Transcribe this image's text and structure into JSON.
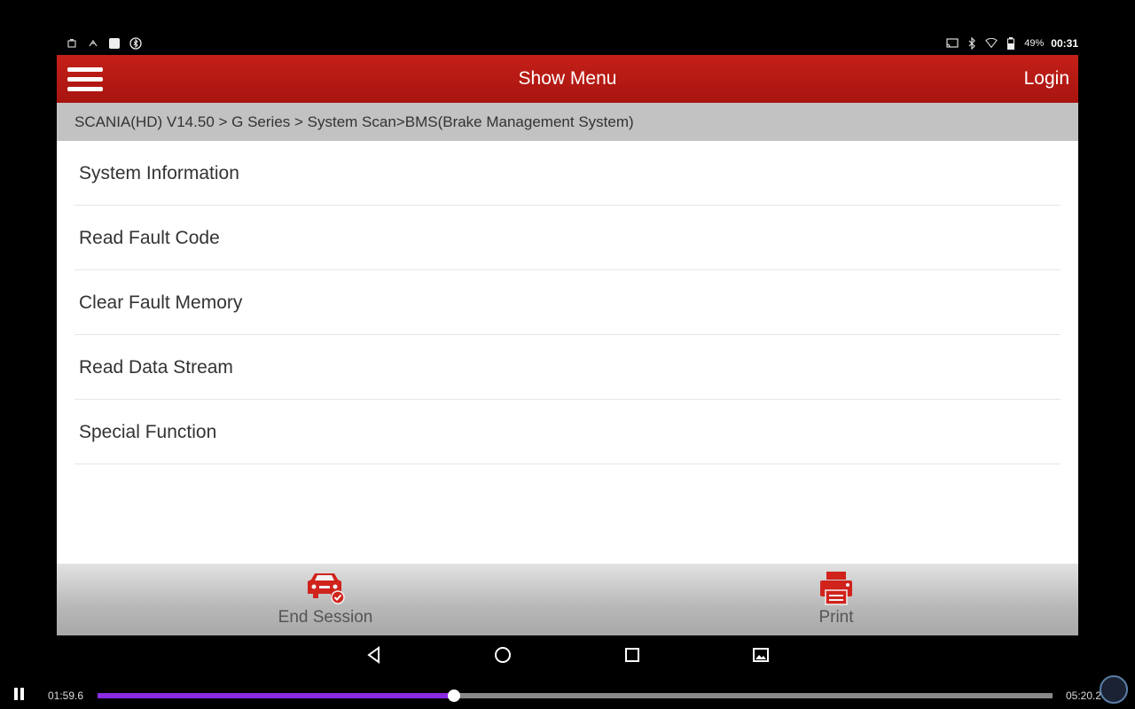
{
  "status_bar": {
    "battery": "49%",
    "time": "00:31",
    "icons_left": [
      "screenshot-icon",
      "usb-debug-icon",
      "notification-icon",
      "bluetooth-settings-icon"
    ],
    "icons_right": [
      "cast-icon",
      "bluetooth-icon",
      "wifi-icon",
      "battery-icon"
    ]
  },
  "header": {
    "title": "Show Menu",
    "login_label": "Login"
  },
  "breadcrumb": "SCANIA(HD) V14.50 > G Series > System Scan>BMS(Brake Management System)",
  "menu": {
    "items": [
      {
        "label": "System Information"
      },
      {
        "label": "Read Fault Code"
      },
      {
        "label": "Clear Fault Memory"
      },
      {
        "label": "Read Data Stream"
      },
      {
        "label": "Special Function"
      }
    ]
  },
  "bottom_bar": {
    "end_session_label": "End Session",
    "print_label": "Print"
  },
  "player": {
    "current_time": "01:59.6",
    "total_time": "05:20.2",
    "progress": 0.373
  },
  "colors": {
    "header": "#b3170f",
    "accent_icon": "#d0231c",
    "seek_fill": "#8a2be2"
  }
}
